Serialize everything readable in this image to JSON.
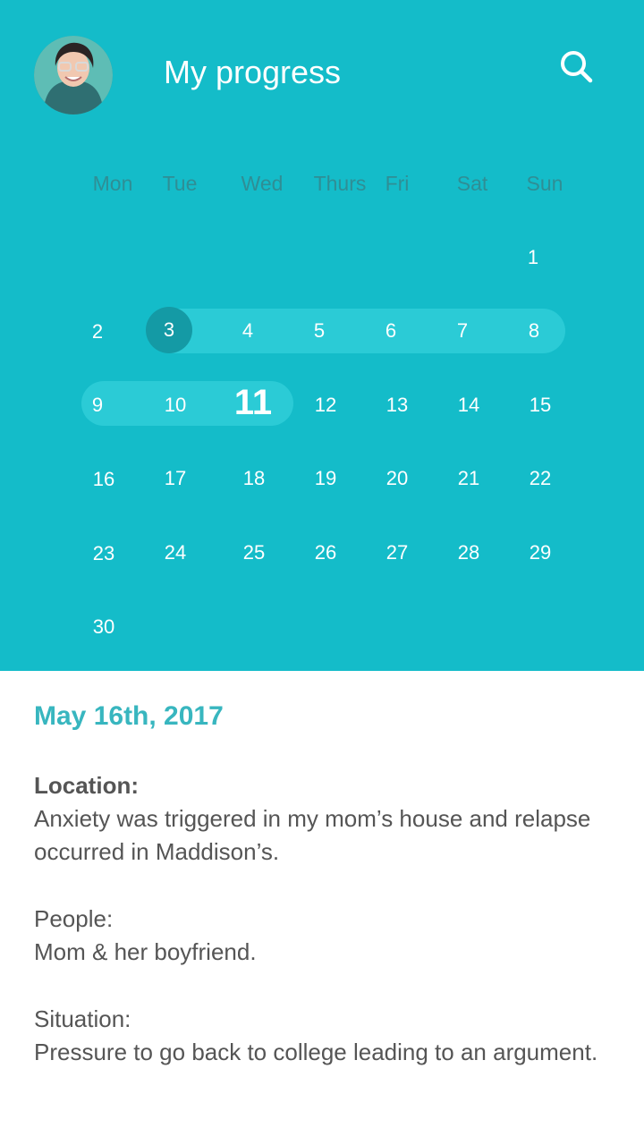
{
  "header": {
    "title": "My progress",
    "background_color": "#14bcc9",
    "avatar_icon": "avatar",
    "search_icon": "search-icon"
  },
  "calendar": {
    "weekdays": [
      "Mon",
      "Tue",
      "Wed",
      "Thurs",
      "Fri",
      "Sat",
      "Sun"
    ],
    "weeks": [
      [
        "",
        "",
        "",
        "",
        "",
        "",
        "1"
      ],
      [
        "2",
        "3",
        "4",
        "5",
        "6",
        "7",
        "8"
      ],
      [
        "9",
        "10",
        "11",
        "12",
        "13",
        "14",
        "15"
      ],
      [
        "16",
        "17",
        "18",
        "19",
        "20",
        "21",
        "22"
      ],
      [
        "23",
        "24",
        "25",
        "26",
        "27",
        "28",
        "29"
      ],
      [
        "30",
        "",
        "",
        "",
        "",
        "",
        ""
      ]
    ],
    "selected_range_start": "3",
    "today": "11",
    "highlight_color": "#2bcbd6"
  },
  "details": {
    "date": "May 16th, 2017",
    "location_label": "Location:",
    "location_text": "Anxiety was triggered in my mom’s house and relapse occurred in Maddison’s.",
    "people_label": "People:",
    "people_text": "Mom & her boyfriend.",
    "situation_label": "Situation:",
    "situation_text": "Pressure to go back to college leading to an argument."
  }
}
